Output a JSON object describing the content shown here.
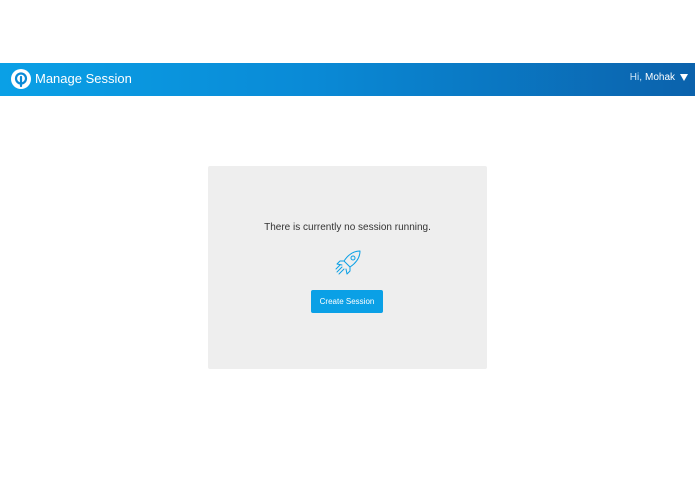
{
  "header": {
    "title": "Manage Session",
    "greeting": "Hi,",
    "username": "Mohak",
    "logo_icon": "q-logo-icon",
    "user_menu_icon": "caret-down-icon",
    "gradient_start": "#0aa0e6",
    "gradient_end": "#0b62ac"
  },
  "main": {
    "empty_message": "There is currently no session running.",
    "illustration_icon": "rocket-icon",
    "create_button_label": "Create Session",
    "accent_color": "#0aa0e6",
    "card_background": "#eeeeee"
  }
}
